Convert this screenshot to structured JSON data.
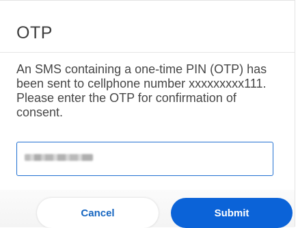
{
  "dialog": {
    "title": "OTP",
    "message": "An SMS containing a one-time PIN (OTP) has been sent to cellphone number xxxxxxxxx111. Please enter the OTP for confirmation of consent.",
    "otp_input": {
      "value": "",
      "placeholder": ""
    },
    "buttons": {
      "cancel_label": "Cancel",
      "submit_label": "Submit"
    }
  },
  "colors": {
    "accent": "#0b63d8",
    "input_border": "#1f6fd1",
    "text": "#464646"
  }
}
